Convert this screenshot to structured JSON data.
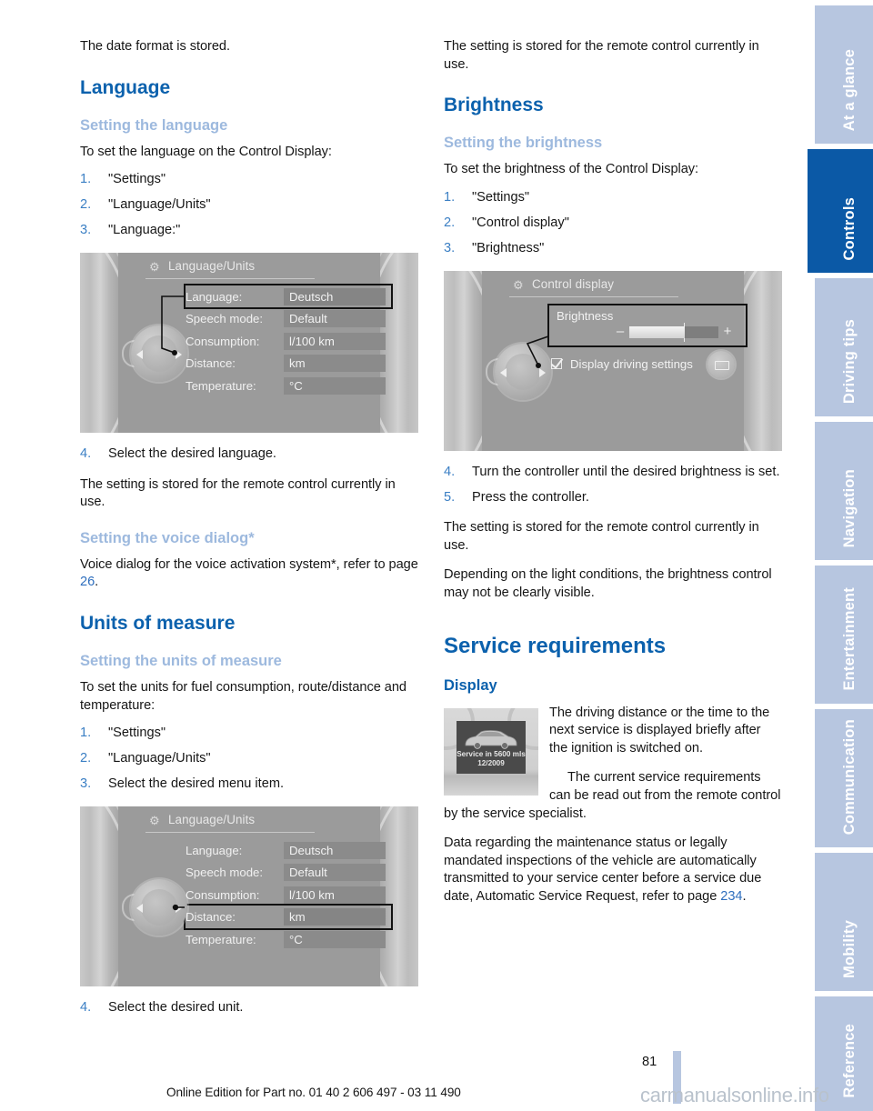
{
  "document": {
    "page_number": "81",
    "footer": "Online Edition for Part no. 01 40 2 606 497 - 03 11 490",
    "watermark": "carmanualsonline.info"
  },
  "colors": {
    "heading_blue": "#0b61ad",
    "subheading_light_blue": "#9db9de",
    "tab_inactive": "#b7c6e0",
    "tab_active": "#0b59a6",
    "link_blue": "#2f6fbe"
  },
  "left_column": {
    "intro": "The date format is stored.",
    "language_heading": "Language",
    "setting_language_heading": "Setting the language",
    "setting_language_intro": "To set the language on the Control Display:",
    "language_steps": [
      {
        "num": "1",
        "text": "\"Settings\""
      },
      {
        "num": "2",
        "text": "\"Language/Units\""
      },
      {
        "num": "3",
        "text": "\"Language:\""
      }
    ],
    "language_step4": {
      "num": "4",
      "text": "Select the desired language."
    },
    "stored_note": "The setting is stored for the remote control currently in use.",
    "voice_dialog_heading": "Setting the voice dialog*",
    "voice_dialog_text_before": "Voice dialog for the voice activation system*, refer to page ",
    "voice_dialog_page_ref": "26",
    "voice_dialog_text_after": ".",
    "units_heading": "Units of measure",
    "units_sub_heading": "Setting the units of measure",
    "units_intro": "To set the units for fuel consumption, route/distance and temperature:",
    "units_steps": [
      {
        "num": "1",
        "text": "\"Settings\""
      },
      {
        "num": "2",
        "text": "\"Language/Units\""
      },
      {
        "num": "3",
        "text": "Select the desired menu item."
      }
    ],
    "units_step4": {
      "num": "4",
      "text": "Select the desired unit."
    }
  },
  "right_column": {
    "stored_note_top": "The setting is stored for the remote control currently in use.",
    "brightness_heading": "Brightness",
    "setting_brightness_heading": "Setting the brightness",
    "setting_brightness_intro": "To set the brightness of the Control Display:",
    "brightness_steps": [
      {
        "num": "1",
        "text": "\"Settings\""
      },
      {
        "num": "2",
        "text": "\"Control display\""
      },
      {
        "num": "3",
        "text": "\"Brightness\""
      }
    ],
    "brightness_step4": {
      "num": "4",
      "text": "Turn the controller until the desired brightness is set."
    },
    "brightness_step5": {
      "num": "5",
      "text": "Press the controller."
    },
    "stored_note_bottom": "The setting is stored for the remote control currently in use.",
    "light_conditions_note": "Depending on the light conditions, the brightness control may not be clearly visible.",
    "service_heading": "Service requirements",
    "display_heading": "Display",
    "display_para1": "The driving distance or the time to the next service is displayed briefly after the ignition is switched on.",
    "display_para2": "The current service requirements can be read out from the remote control by the service specialist.",
    "display_para3_before": "Data regarding the maintenance status or legally mandated inspections of the vehicle are automatically transmitted to your service center before a service due date, Automatic Service Request, refer to page ",
    "display_para3_ref": "234",
    "display_para3_after": "."
  },
  "idrive_language": {
    "title": "Language/Units",
    "rows": [
      {
        "label": "Language:",
        "value": "Deutsch",
        "selected": true
      },
      {
        "label": "Speech mode:",
        "value": "Default",
        "selected": false
      },
      {
        "label": "Consumption:",
        "value": "l/100 km",
        "selected": false
      },
      {
        "label": "Distance:",
        "value": "km",
        "selected": false
      },
      {
        "label": "Temperature:",
        "value": "°C",
        "selected": false
      }
    ]
  },
  "idrive_units": {
    "title": "Language/Units",
    "rows": [
      {
        "label": "Language:",
        "value": "Deutsch",
        "selected": false
      },
      {
        "label": "Speech mode:",
        "value": "Default",
        "selected": false
      },
      {
        "label": "Consumption:",
        "value": "l/100 km",
        "selected": false
      },
      {
        "label": "Distance:",
        "value": "km",
        "selected": true
      },
      {
        "label": "Temperature:",
        "value": "°C",
        "selected": false
      }
    ]
  },
  "idrive_control_display": {
    "title": "Control display",
    "brightness_label": "Brightness",
    "slider": {
      "minus": "–",
      "plus": "+",
      "fill_percent": 62
    },
    "checkbox_label": "Display driving settings",
    "checkbox_checked": true
  },
  "service_thumbnail": {
    "line1": "Service in 5600 mls",
    "line2": "12/2009"
  },
  "tabs": [
    {
      "label": "At a glance",
      "active": false
    },
    {
      "label": "Controls",
      "active": true
    },
    {
      "label": "Driving tips",
      "active": false
    },
    {
      "label": "Navigation",
      "active": false
    },
    {
      "label": "Entertainment",
      "active": false
    },
    {
      "label": "Communication",
      "active": false
    },
    {
      "label": "Mobility",
      "active": false
    },
    {
      "label": "Reference",
      "active": false
    }
  ]
}
